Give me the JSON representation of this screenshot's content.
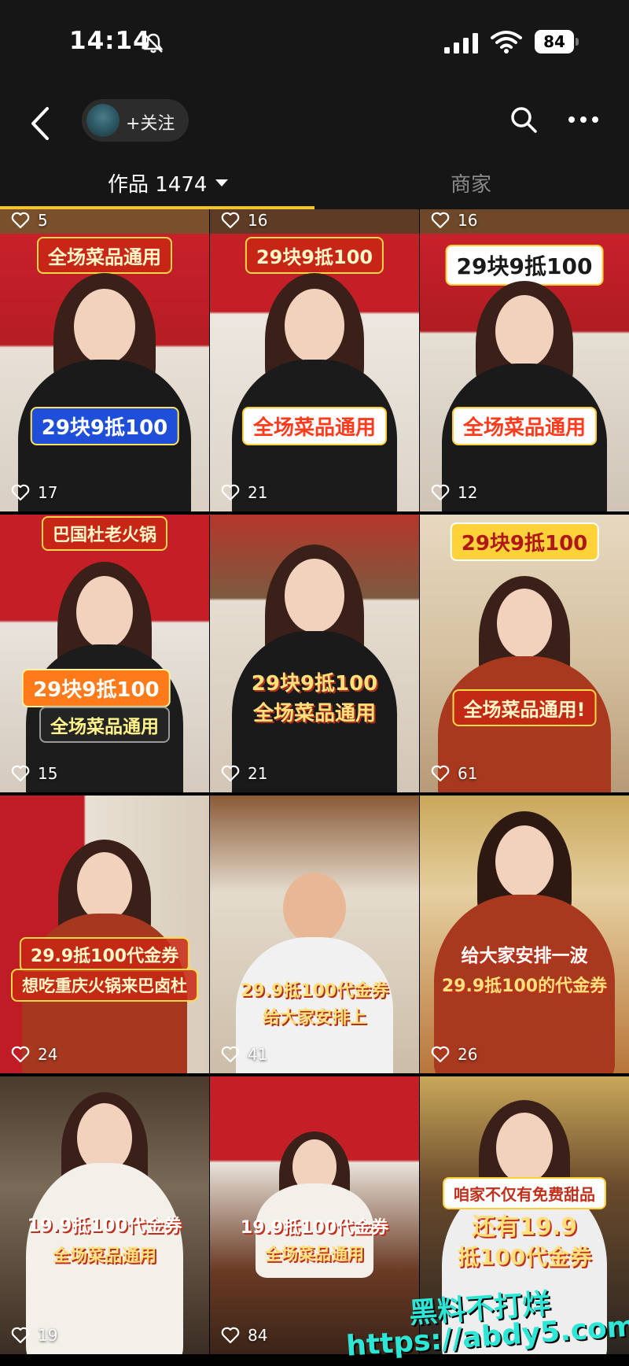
{
  "status_bar": {
    "time": "14:14",
    "battery": "84",
    "icons": [
      "bell-off-icon",
      "signal-icon",
      "wifi-icon",
      "battery-icon"
    ]
  },
  "nav": {
    "follow_label": "+关注",
    "icons": [
      "back-icon",
      "avatar",
      "search-icon",
      "more-icon"
    ]
  },
  "tabs": {
    "works_label": "作品 1474",
    "merchant_label": "商家",
    "accent_color": "#f1c232"
  },
  "top_partial_row": [
    {
      "likes": "5"
    },
    {
      "likes": "16"
    },
    {
      "likes": "16"
    }
  ],
  "videos": [
    {
      "likes": "17",
      "captions": [
        "全场菜品通用",
        "29块9抵100"
      ]
    },
    {
      "likes": "21",
      "captions": [
        "29块9抵100",
        "全场菜品通用"
      ]
    },
    {
      "likes": "12",
      "captions": [
        "29块9抵100",
        "全场菜品通用"
      ]
    },
    {
      "likes": "15",
      "captions": [
        "巴国杜老火锅",
        "29块9抵100",
        "全场菜品通用"
      ]
    },
    {
      "likes": "21",
      "captions": [
        "29块9抵100",
        "全场菜品通用"
      ]
    },
    {
      "likes": "61",
      "captions": [
        "29块9抵100",
        "全场菜品通用!"
      ]
    },
    {
      "likes": "24",
      "captions": [
        "29.9抵100代金券",
        "想吃重庆火锅来巴卤杜"
      ]
    },
    {
      "likes": "41",
      "captions": [
        "29.9抵100代金券",
        "给大家安排上"
      ]
    },
    {
      "likes": "26",
      "captions": [
        "给大家安排一波",
        "29.9抵100的代金券"
      ]
    },
    {
      "likes": "19",
      "captions": [
        "19.9抵100代金券",
        "全场菜品通用"
      ]
    },
    {
      "likes": "84",
      "captions": [
        "19.9抵100代金券",
        "全场菜品通用"
      ]
    },
    {
      "likes": "",
      "captions": [
        "咱家不仅有免费甜品",
        "还有19.9",
        "抵100代金券"
      ]
    }
  ],
  "watermark": {
    "line1": "黑料不打烊",
    "line2": "https://abdy5.com"
  }
}
